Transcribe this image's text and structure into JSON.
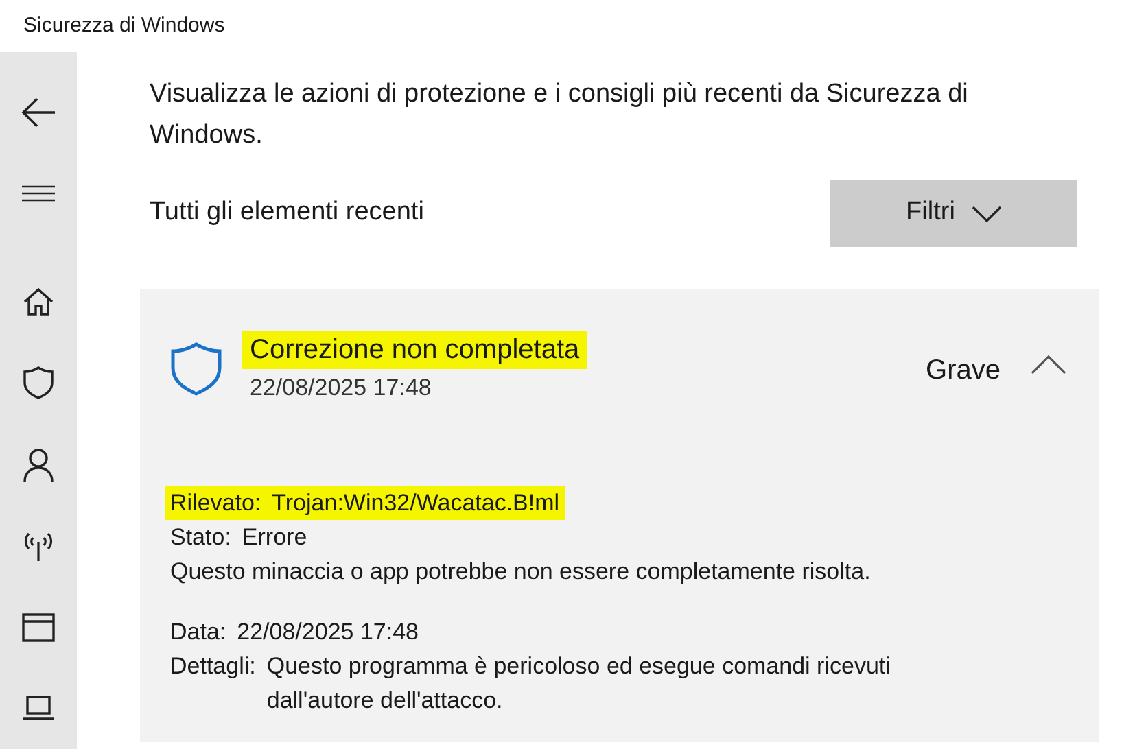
{
  "window": {
    "title": "Sicurezza di Windows"
  },
  "sidebar": {
    "items": [
      {
        "kind": "back"
      },
      {
        "kind": "menu"
      },
      {
        "kind": "home"
      },
      {
        "kind": "shield"
      },
      {
        "kind": "account"
      },
      {
        "kind": "network"
      },
      {
        "kind": "browser"
      },
      {
        "kind": "device"
      }
    ]
  },
  "intro": "Visualizza le azioni di protezione e i consigli più recenti da Sicurezza di Windows.",
  "section_title": "Tutti gli elementi recenti",
  "filter_button": "Filtri",
  "event": {
    "title": "Correzione non completata",
    "title_highlighted": true,
    "date": "22/08/2025 17:48",
    "severity": "Grave",
    "expanded": true,
    "details": [
      {
        "kind": "field",
        "label": "Rilevato:",
        "value": "Trojan:Win32/Wacatac.B!ml",
        "highlighted": true
      },
      {
        "kind": "field",
        "label": "Stato:",
        "value": "Errore",
        "highlighted": false
      },
      {
        "kind": "note",
        "text": "Questo minaccia o app potrebbe non essere completamente risolta."
      },
      {
        "kind": "gap"
      },
      {
        "kind": "field",
        "label": "Data:",
        "value": "22/08/2025 17:48",
        "highlighted": false
      },
      {
        "kind": "field",
        "label": "Dettagli:",
        "value": "Questo programma è pericoloso ed esegue comandi ricevuti dall'autore dell'attacco.",
        "highlighted": false
      }
    ]
  }
}
